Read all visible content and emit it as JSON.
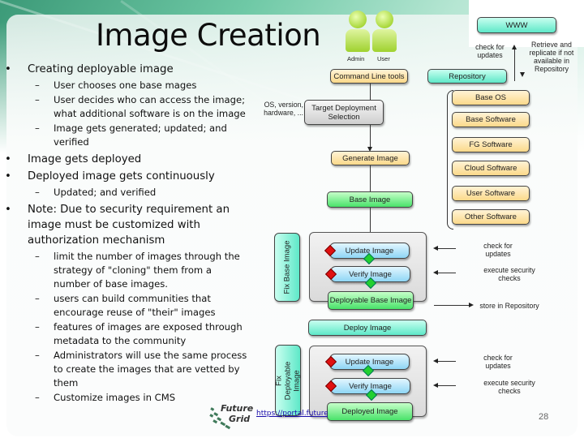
{
  "slide": {
    "title": "Image Creation",
    "page_number": "28",
    "link_text": "https://portal.futuregrid.org",
    "logo": {
      "line1": "Future",
      "line2": "Grid"
    }
  },
  "bullets": [
    {
      "level": 1,
      "marker": "•",
      "text": "Creating deployable image"
    },
    {
      "level": 2,
      "marker": "–",
      "text": "User chooses one base mages"
    },
    {
      "level": 2,
      "marker": "–",
      "text": "User decides who can access the image; what additional software is on the image"
    },
    {
      "level": 2,
      "marker": "–",
      "text": "Image gets generated; updated; and verified"
    },
    {
      "level": 1,
      "marker": "•",
      "text": "Image gets deployed"
    },
    {
      "level": 1,
      "marker": "•",
      "text": "Deployed image gets continuously"
    },
    {
      "level": 2,
      "marker": "–",
      "text": "Updated; and verified"
    },
    {
      "level": 1,
      "marker": "•",
      "text": "Note: Due to security requirement an image must be customized with authorization mechanism"
    },
    {
      "level": 2,
      "marker": "–",
      "text": "limit the number of images through the strategy of \"cloning\" them from a number of base images."
    },
    {
      "level": 2,
      "marker": "–",
      "text": "users can build communities that encourage reuse of \"their\" images"
    },
    {
      "level": 2,
      "marker": "–",
      "text": "features of images are exposed through metadata to the community"
    },
    {
      "level": 2,
      "marker": "–",
      "text": "Administrators will use the same process to create the images that are vetted by them"
    },
    {
      "level": 2,
      "marker": "–",
      "text": "Customize images in CMS"
    }
  ],
  "diagram": {
    "actors": [
      {
        "label": "Admin",
        "icon": "person-icon"
      },
      {
        "label": "User",
        "icon": "person-icon"
      }
    ],
    "www": "WWW",
    "check_for_updates_top": "check for updates",
    "retrieve_note": "Retrieve and replicate if not available in Repository",
    "command_line_tools": "Command Line tools",
    "repository": "Repository",
    "target_note": "OS, version, hardware, ...",
    "target_selection": "Target Deployment Selection",
    "generate_image": "Generate Image",
    "software_stack": [
      "Base OS",
      "Base Software",
      "FG Software",
      "Cloud Software",
      "User Software",
      "Other Software"
    ],
    "base_image": "Base Image",
    "fix_base_image": "Fix Base Image",
    "update_image": "Update Image",
    "verify_image": "Verify Image",
    "deployable_base_image": "Deployable Base Image",
    "deploy_image": "Deploy Image",
    "fix_deployable_image": "Fix Deployable Image",
    "deployed_image": "Deployed Image",
    "side_notes_1": {
      "check": "check for updates",
      "security": "execute security checks",
      "store": "store in Repository"
    },
    "side_notes_2": {
      "check": "check for updates",
      "security": "execute security checks"
    }
  }
}
